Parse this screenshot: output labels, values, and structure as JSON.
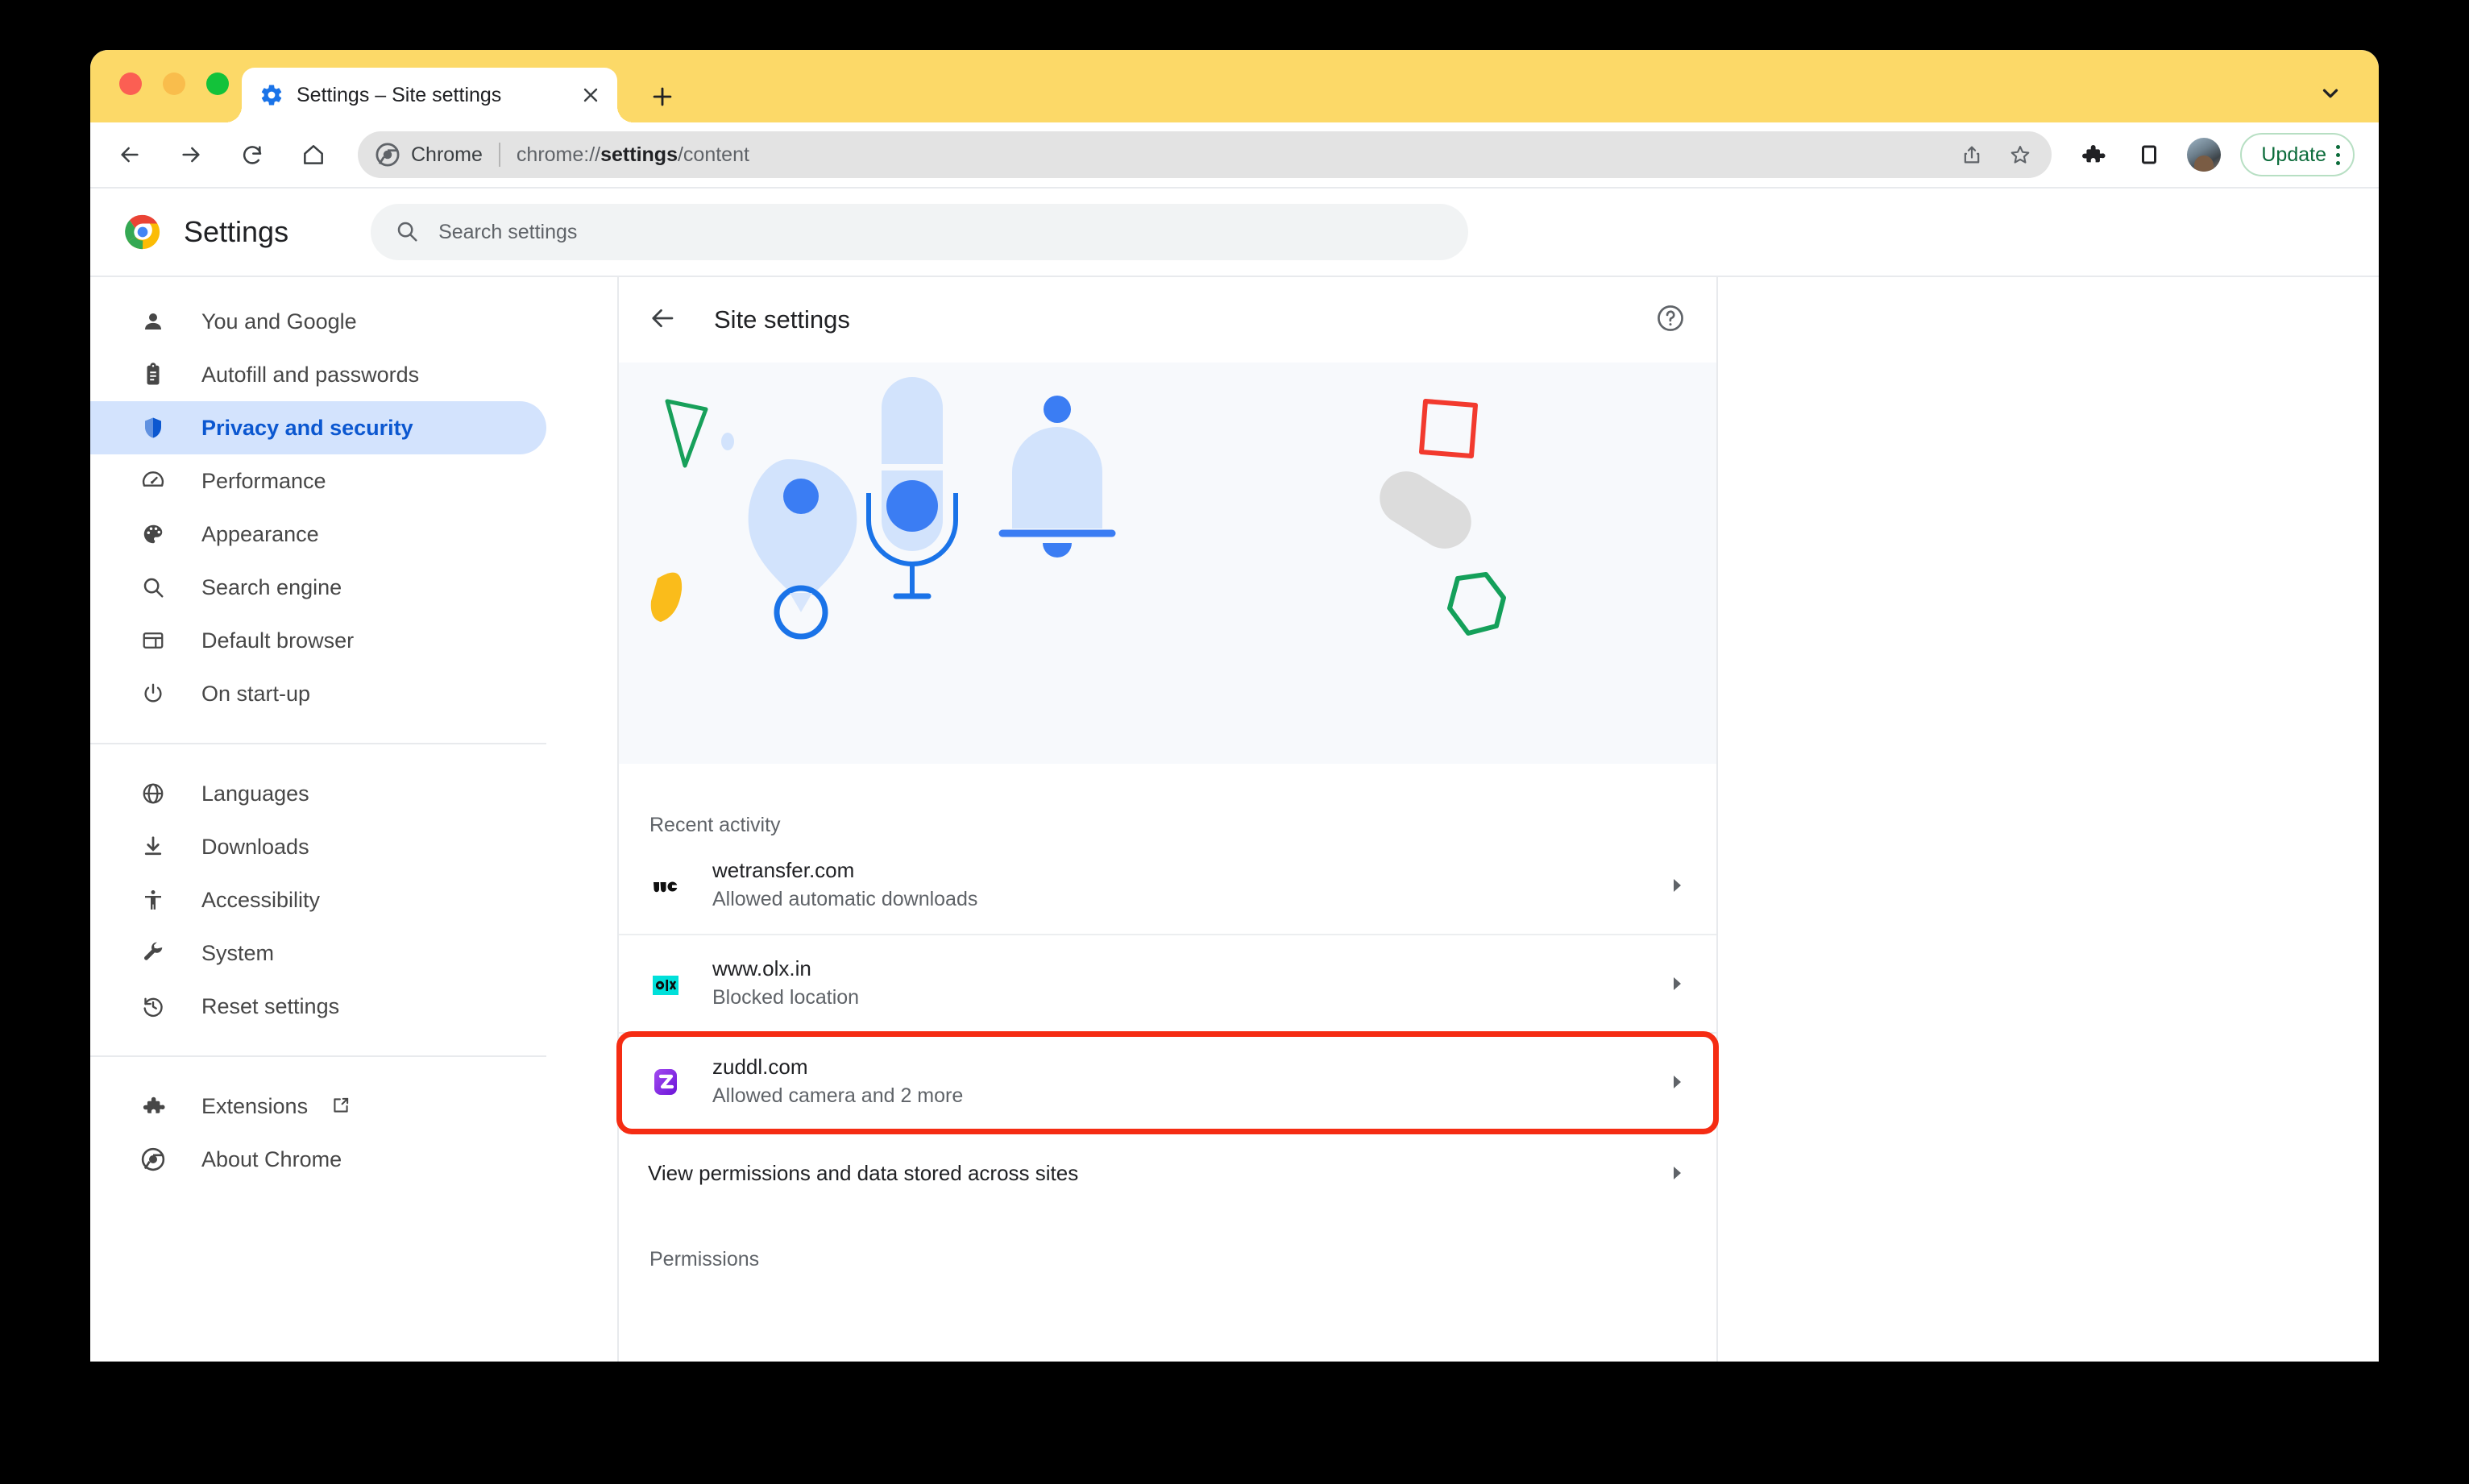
{
  "window": {
    "chevron_icon": "chevron-down-icon"
  },
  "tab": {
    "title": "Settings – Site settings",
    "favicon_icon": "settings-gear-icon",
    "close_icon": "close-icon",
    "new_tab_icon": "plus-icon"
  },
  "toolbar": {
    "back_icon": "arrow-left-icon",
    "forward_icon": "arrow-right-icon",
    "reload_icon": "reload-icon",
    "home_icon": "home-icon",
    "omnibox": {
      "chrome_icon": "chrome-icon",
      "chrome_label": "Chrome",
      "url_prefix": "chrome://",
      "url_bold": "settings",
      "url_suffix": "/content",
      "share_icon": "share-icon",
      "bookmark_icon": "star-icon"
    },
    "extensions_icon": "puzzle-piece-icon",
    "side_panel_icon": "side-panel-icon",
    "avatar_icon": "profile-avatar",
    "update_label": "Update",
    "update_menu_icon": "kebab-menu-icon",
    "update_color": "#0b6b3a"
  },
  "settings_header": {
    "logo_icon": "chrome-logo-icon",
    "title": "Settings",
    "search_icon": "search-icon",
    "search_placeholder": "Search settings",
    "search_value": ""
  },
  "sidebar": {
    "group_main": [
      {
        "label": "You and Google",
        "icon": "person-icon",
        "selected": false
      },
      {
        "label": "Autofill and passwords",
        "icon": "clipboard-icon",
        "selected": false
      },
      {
        "label": "Privacy and security",
        "icon": "shield-icon",
        "selected": true
      },
      {
        "label": "Performance",
        "icon": "speedometer-icon",
        "selected": false
      },
      {
        "label": "Appearance",
        "icon": "palette-icon",
        "selected": false
      },
      {
        "label": "Search engine",
        "icon": "search-icon",
        "selected": false
      },
      {
        "label": "Default browser",
        "icon": "browser-window-icon",
        "selected": false
      },
      {
        "label": "On start-up",
        "icon": "power-icon",
        "selected": false
      },
      {
        "label": "Languages",
        "icon": "globe-icon",
        "selected": false
      },
      {
        "label": "Downloads",
        "icon": "download-icon",
        "selected": false
      },
      {
        "label": "Accessibility",
        "icon": "accessibility-icon",
        "selected": false
      },
      {
        "label": "System",
        "icon": "wrench-icon",
        "selected": false
      },
      {
        "label": "Reset settings",
        "icon": "history-restore-icon",
        "selected": false
      }
    ],
    "group_footer": [
      {
        "label": "Extensions",
        "icon": "puzzle-piece-icon",
        "external": true
      },
      {
        "label": "About Chrome",
        "icon": "chrome-icon",
        "external": false
      }
    ],
    "selected_color": "#0b57d0",
    "selected_bg": "#d3e3fd"
  },
  "page": {
    "back_icon": "arrow-left-icon",
    "heading": "Site settings",
    "help_icon": "help-circle-icon"
  },
  "illustration": {
    "alt": "site-permissions-illustration",
    "shapes": [
      "green-triangle-outline",
      "small-blue-dot",
      "yellow-blob",
      "location-pin",
      "microphone",
      "notification-bell",
      "red-square-outline",
      "grey-capsule",
      "green-hexagon-outline"
    ],
    "background": "#f7f9fc",
    "accent_blue": "#3b7df3",
    "light_blue": "#d2e3fc"
  },
  "recent_activity": {
    "label": "Recent activity",
    "items": [
      {
        "site": "wetransfer.com",
        "status": "Allowed automatic downloads",
        "favicon": "wetransfer-favicon",
        "chevron": "chevron-right-icon",
        "highlighted": false
      },
      {
        "site": "www.olx.in",
        "status": "Blocked location",
        "favicon": "olx-favicon",
        "chevron": "chevron-right-icon",
        "highlighted": false
      },
      {
        "site": "zuddl.com",
        "status": "Allowed camera and 2 more",
        "favicon": "zuddl-favicon",
        "chevron": "chevron-right-icon",
        "highlighted": true
      }
    ],
    "highlight_color": "#f52c13"
  },
  "view_permissions": {
    "label": "View permissions and data stored across sites",
    "chevron": "chevron-right-icon"
  },
  "permissions": {
    "label": "Permissions"
  }
}
